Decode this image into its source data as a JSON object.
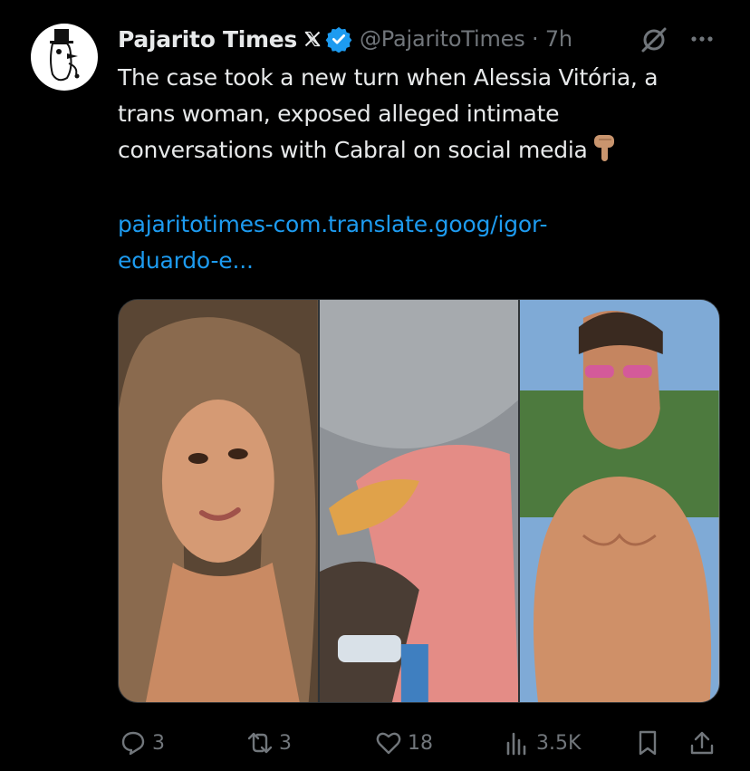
{
  "tweet": {
    "author_name": "Pajarito Times",
    "handle_time": "@PajaritoTimes · 7h",
    "text_lines": [
      "The case took a new turn when Alessia Vitória, a",
      "trans woman, exposed alleged intimate",
      "conversations with Cabral on social media"
    ],
    "link_lines": [
      "pajaritotimes-com.translate.goog/igor-",
      "eduardo-e..."
    ]
  },
  "icons": {
    "avatar": "top-hat-bird-logo",
    "x_badge": "x-logo-icon",
    "verified": "verified-badge-icon",
    "grok": "grok-icon",
    "more": "more-icon",
    "emoji": "pointing-down-emoji"
  },
  "media": [
    "photo-woman",
    "photo-screen-blur",
    "photo-man-sunglasses"
  ],
  "actions": {
    "reply_count": "3",
    "repost_count": "3",
    "like_count": "18",
    "views_count": "3.5K"
  },
  "colors": {
    "accent": "#1d9bf0",
    "muted": "#71767b",
    "text": "#e7e9ea",
    "background": "#000000"
  }
}
